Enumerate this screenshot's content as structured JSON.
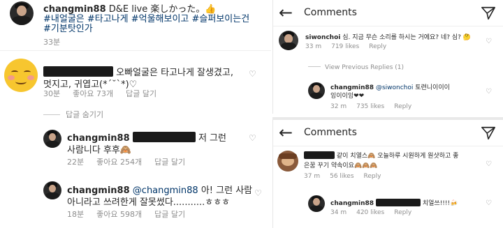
{
  "left": {
    "caption": {
      "username": "changmin88",
      "text": " D&E live 楽しかった。👍",
      "hashtags_line2": "#내얼굴은 #타고나게 #억울해보이고 #슬퍼보이는건",
      "hashtags_line3": "#기분탓인가",
      "time": "33분"
    },
    "comment1": {
      "text_line1": "오빠얼굴은 타고나게 잘생겼고,",
      "text_line2": "멋지고, 귀엽고(*´˘`*)♡",
      "time": "30분",
      "likes": "좋아요 73개",
      "reply": "답글 달기"
    },
    "hide_replies": "답글 숨기기",
    "reply1": {
      "username": "changmin88",
      "text_after": "저 그런",
      "text_line2": "사람니다 후후🙈",
      "time": "22분",
      "likes": "좋아요 254개",
      "reply": "답글 달기"
    },
    "reply2": {
      "username": "changmin88",
      "mention": "@changmin88",
      "text_line1": " 아! 그런 사람",
      "text_line2": "아니라고 쓰려한게 잘못썼다...........ㅎㅎㅎ",
      "time": "18분",
      "likes": "좋아요 598개",
      "reply": "답글 달기"
    }
  },
  "right_top": {
    "header_title": "Comments",
    "comment": {
      "username": "siwonchoi",
      "text": " 심. 지금 무슨 소리를 하시는 거에요? 네? 심? 🤔",
      "time": "33 m",
      "likes": "719 likes",
      "reply": "Reply"
    },
    "view_previous": "View Previous Replies (1)",
    "reply": {
      "username": "changmin88",
      "mention": "@siwonchoi",
      "text_line1": " 토련니이이이",
      "text_line2": "잉이이잉❤❤",
      "time": "32 m",
      "likes": "735 likes",
      "reply": "Reply"
    }
  },
  "right_bottom": {
    "header_title": "Comments",
    "comment": {
      "text_line1": "같이 치열스🙈 오늘하루 시원하게 원샷하고 좋",
      "text_line2": "은꿈 꾸기 약속이요🙈🙈🙈",
      "time": "37 m",
      "likes": "56 likes",
      "reply": "Reply"
    },
    "reply": {
      "username": "changmin88",
      "text_after": "치얼쓰!!!!🍻",
      "time": "34 m",
      "likes": "420 likes",
      "reply": "Reply"
    }
  },
  "colors": {
    "hashtag": "#003569",
    "meta": "#8e8e8e",
    "heart_red": "#ed4956"
  }
}
